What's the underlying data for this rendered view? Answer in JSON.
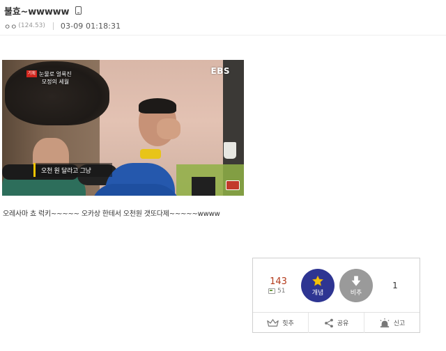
{
  "post": {
    "title": "불효~wwwww",
    "nickname": "ㅇㅇ",
    "ip": "(124.53)",
    "date": "03-09 01:18:31",
    "body": "오레사마 쵸 럭키~~~~~ 오카상 한테서 오천원 갯또다제~~~~~wwww"
  },
  "image": {
    "channel_logo": "EBS",
    "program_badge": "기획",
    "program_title_1": "눈물로 얼룩진",
    "program_title_2": "모정의 세월",
    "subtitle": "오천 원 달라고 그냥"
  },
  "recommend": {
    "up_count": "143",
    "fixed_count": "51",
    "up_label": "개념",
    "down_label": "비추",
    "down_count": "1",
    "up_color": "#2e3592",
    "down_color": "#9a9a9a",
    "count_color": "#b33a1b"
  },
  "actions": {
    "recommend_label": "힛추",
    "share_label": "공유",
    "report_label": "신고"
  },
  "icons": {
    "mobile": "mobile-icon",
    "star": "star-icon",
    "down_arrow": "down-arrow-icon",
    "crown": "crown-icon",
    "share": "share-icon",
    "siren": "siren-icon"
  }
}
